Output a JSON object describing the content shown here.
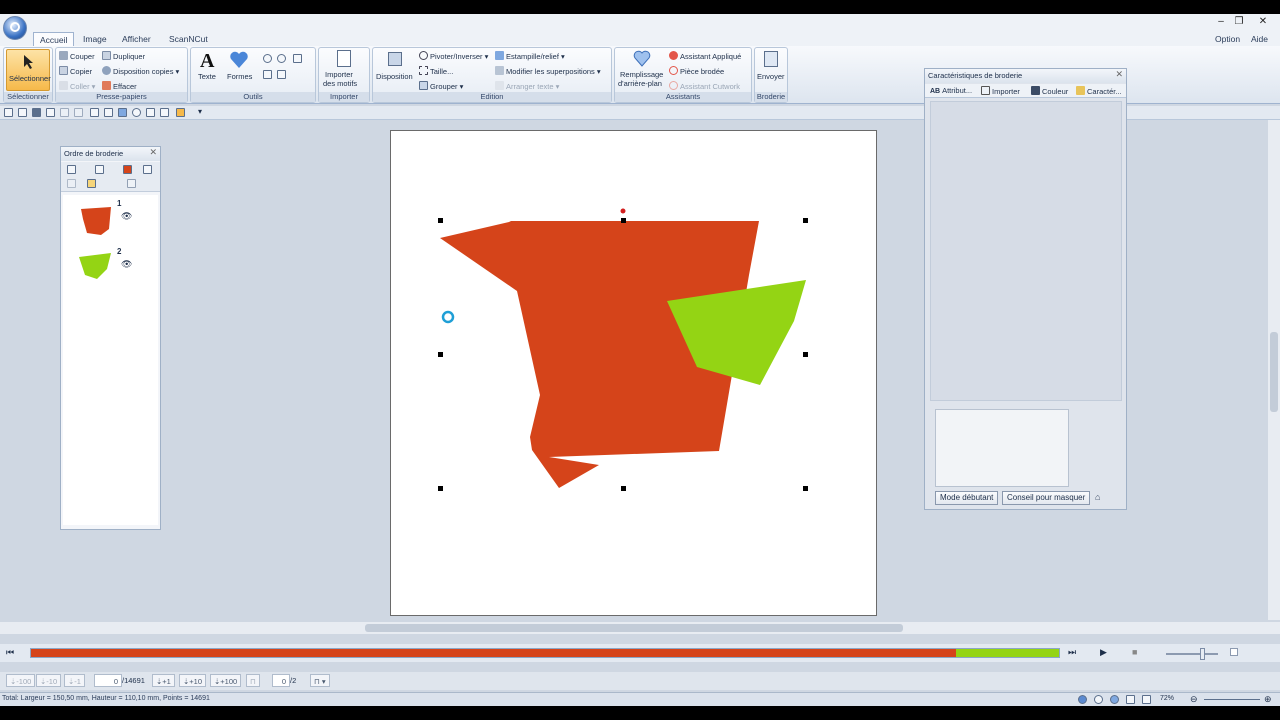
{
  "window": {
    "controls": [
      "–",
      "❐",
      "✕"
    ]
  },
  "tabs": [
    {
      "label": "Accueil",
      "active": true
    },
    {
      "label": "Image"
    },
    {
      "label": "Afficher"
    },
    {
      "label": "ScanNCut"
    }
  ],
  "right_menu": {
    "option": "Option",
    "aide": "Aide"
  },
  "ribbon": {
    "selectionner": {
      "button": "Sélectionner",
      "group": "Sélectionner"
    },
    "presse": {
      "couper": "Couper",
      "copier": "Copier",
      "coller": "Coller",
      "dupliquer": "Dupliquer",
      "disposition_copies": "Disposition copies",
      "effacer": "Effacer",
      "group": "Presse-papiers"
    },
    "outils": {
      "texte": "Texte",
      "formes": "Formes",
      "group": "Outils"
    },
    "importer": {
      "button_line1": "Importer",
      "button_line2": "des motifs",
      "group": "Importer"
    },
    "edition": {
      "disposition": "Disposition",
      "pivoter": "Pivoter/Inverser",
      "taille": "Taille...",
      "grouper": "Grouper",
      "estampille": "Estampille/relief",
      "modifier": "Modifier les superpositions",
      "arranger": "Arranger texte",
      "group": "Edition"
    },
    "assistants": {
      "remplissage_line1": "Remplissage",
      "remplissage_line2": "d'arrière-plan",
      "appliqué": "Assistant Appliqué",
      "piece": "Pièce brodée",
      "cutwork": "Assistant Cutwork",
      "group": "Assistants"
    },
    "broderie": {
      "envoyer": "Envoyer",
      "group": "Broderie"
    }
  },
  "order_panel": {
    "title": "Ordre de broderie",
    "items": [
      {
        "num": "1",
        "color": "#d5441a"
      },
      {
        "num": "2",
        "color": "#94d414"
      }
    ]
  },
  "props_panel": {
    "title": "Caractéristiques de broderie",
    "tabs": [
      {
        "label": "Attribut..."
      },
      {
        "label": "Importer"
      },
      {
        "label": "Couleur"
      },
      {
        "label": "Caractér..."
      }
    ],
    "mode_button": "Mode débutant",
    "conseil_button": "Conseil pour masquer"
  },
  "colors": {
    "red": "#d5441a",
    "green": "#94d414",
    "accent": "#f6b94a"
  },
  "playback": {
    "progress_fraction": 0.9
  },
  "step": {
    "m100": "-100",
    "m10": "-10",
    "m1": "-1",
    "current": "0",
    "total": "/14691",
    "p1": "+1",
    "p10": "+10",
    "p100": "+100",
    "page": "0",
    "pages": "/2"
  },
  "status": {
    "text": "Total: Largeur = 150,50 mm, Hauteur = 110,10 mm, Points = 14691",
    "zoom": "72%"
  }
}
